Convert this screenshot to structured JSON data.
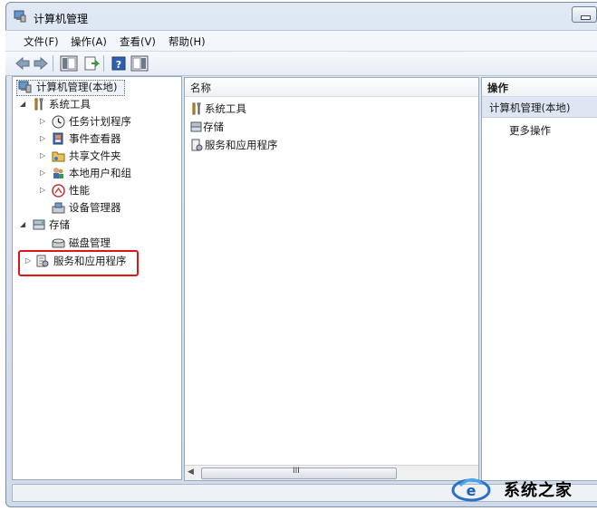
{
  "window": {
    "title": "计算机管理"
  },
  "menu": {
    "file": "文件(F)",
    "action": "操作(A)",
    "view": "查看(V)",
    "help": "帮助(H)"
  },
  "tree": {
    "root": "计算机管理(本地)",
    "system_tools": "系统工具",
    "task_scheduler": "任务计划程序",
    "event_viewer": "事件查看器",
    "shared_folders": "共享文件夹",
    "local_users": "本地用户和组",
    "performance": "性能",
    "device_manager": "设备管理器",
    "storage": "存储",
    "disk_management": "磁盘管理",
    "services_apps": "服务和应用程序"
  },
  "list": {
    "column_name": "名称",
    "items": [
      "系统工具",
      "存储",
      "服务和应用程序"
    ],
    "scroll_grip": "III"
  },
  "actions": {
    "header": "操作",
    "section": "计算机管理(本地)",
    "more": "更多操作"
  },
  "watermark": {
    "text": "系统之家"
  },
  "colors": {
    "highlight_box": "#e0141a",
    "accent": "#2a6fc9"
  }
}
